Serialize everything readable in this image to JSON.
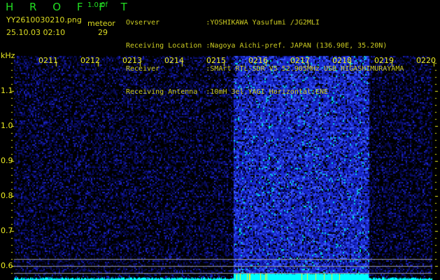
{
  "header": {
    "app_title": "H R O F F T",
    "version": "1.0.0f",
    "filename": "YY2610030210.png",
    "datetime": "25.10.03 02:10",
    "meteor_label": "meteor",
    "meteor_count": "29",
    "info_lines": [
      "Ovserver           :YOSHIKAWA Yasufumi /JG2MLI",
      "Receiving Location :Nagoya Aichi-pref. JAPAN (136.90E, 35.20N)",
      "Receiver           :SMArt RTL-SDR V5 52.905MHz USB HIGASHIMURAYAMA",
      "Receiving Antenna  :10mH 3el.YAGI Horizontal:ENE"
    ]
  },
  "chart_data": {
    "type": "heatmap",
    "ylabel": "kHz",
    "x_tick_labels": [
      "0211",
      "0212",
      "0213",
      "0214",
      "0215",
      "0216",
      "0217",
      "0218",
      "0219",
      "0220"
    ],
    "y_tick_labels": [
      "1.1",
      "1.0",
      "0.9",
      "0.8",
      "0.7",
      "0.6"
    ],
    "ylim": [
      0.57,
      1.21
    ],
    "colors": {
      "background": "#000000",
      "noise": "#1a2aff",
      "strong": "#00ffff",
      "tick": "#eeee22",
      "guide_lines": "#999999"
    },
    "high_noise_interval": [
      "0215.2",
      "0218.4"
    ]
  }
}
